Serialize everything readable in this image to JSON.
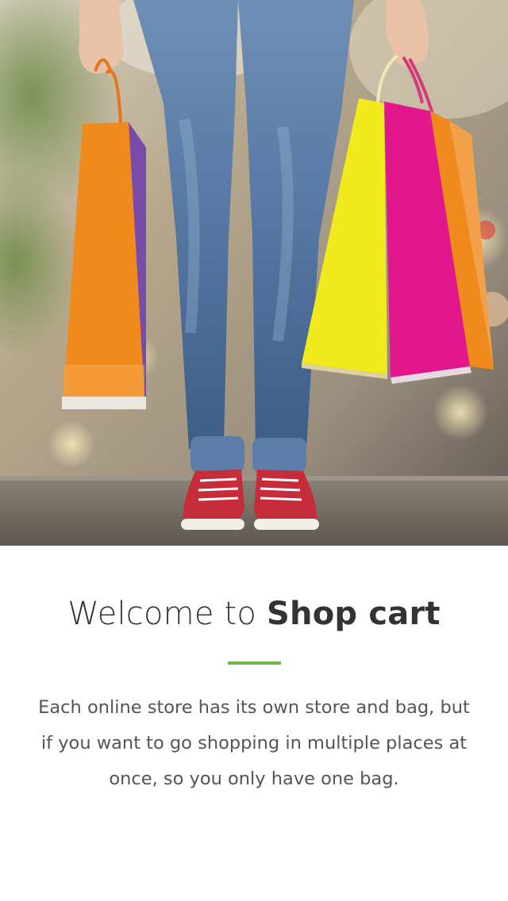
{
  "hero": {
    "image_description_icon": "shopping-bags-photo"
  },
  "welcome": {
    "prefix": "Welcome to",
    "brand": "Shop cart"
  },
  "accent_color": "#74b74a",
  "description": "Each online store has its own store and bag, but if you want to go shopping in multiple places at once, so you only have one bag."
}
